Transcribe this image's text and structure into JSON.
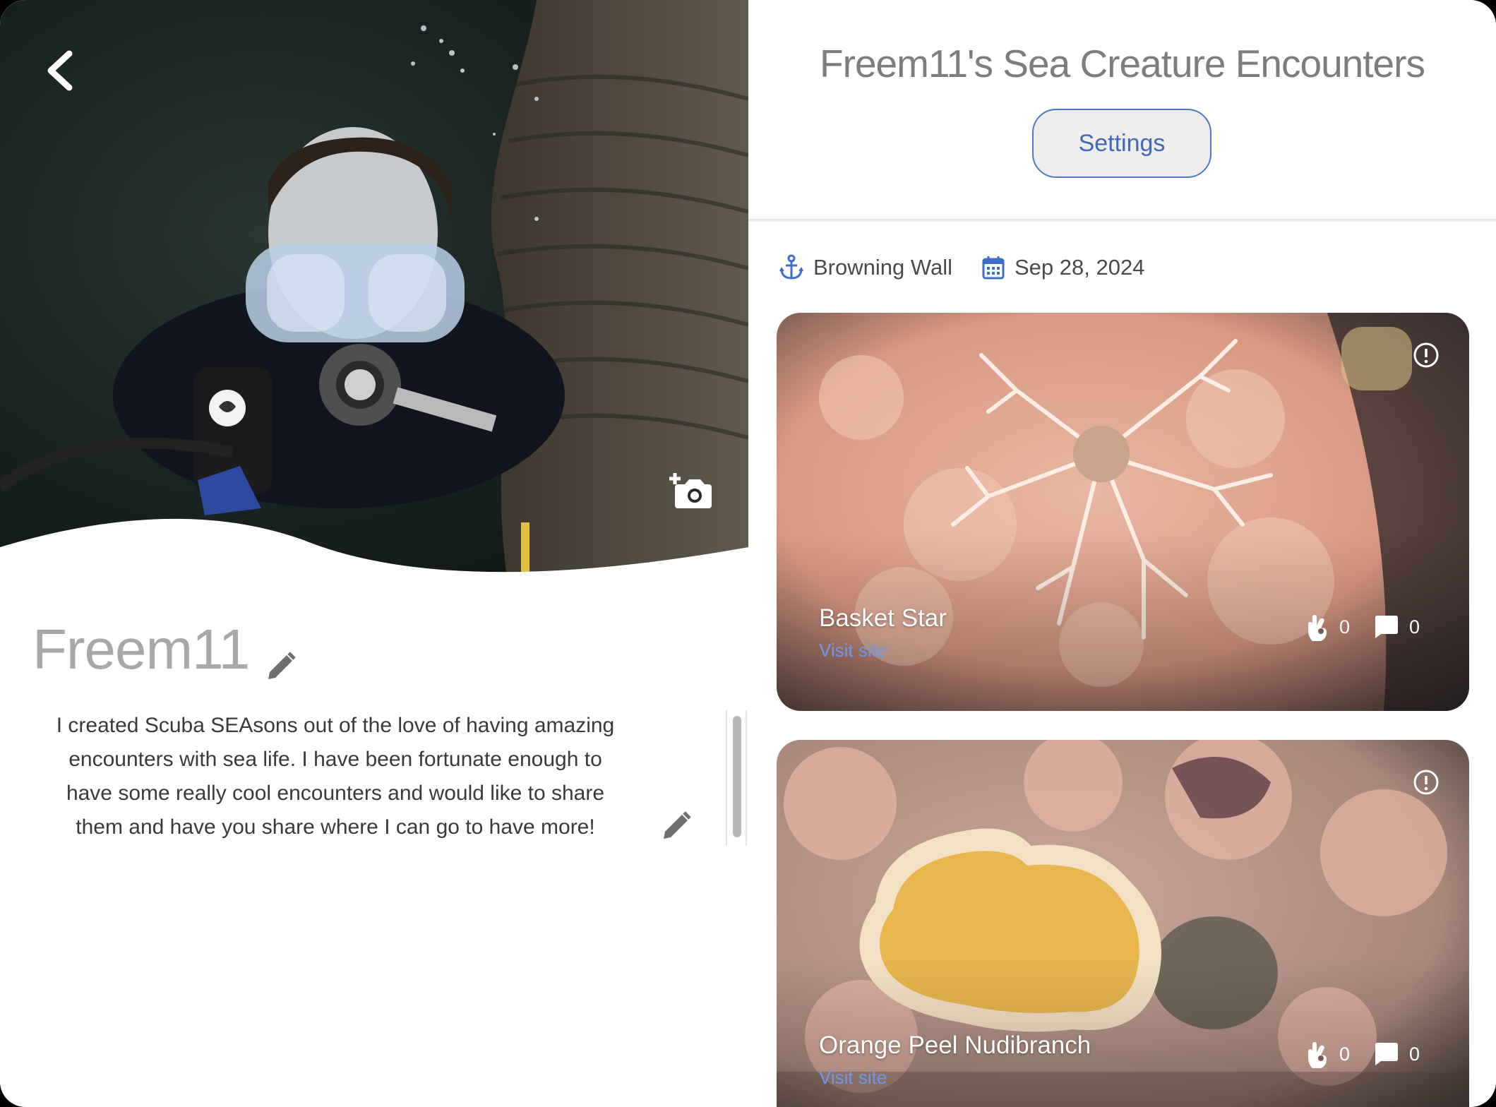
{
  "profile": {
    "username": "Freem11",
    "bio": "I created Scuba SEAsons out of the love of having amazing encounters with sea life. I have been fortunate enough to have some really cool encounters and would like to share them and have you share where I can go to have more!"
  },
  "header": {
    "title": "Freem11's Sea Creature Encounters",
    "settings_label": "Settings"
  },
  "dive": {
    "site": "Browning Wall",
    "date": "Sep 28, 2024"
  },
  "cards": [
    {
      "name": "Basket Star",
      "link": "Visit site",
      "likes": "0",
      "comments": "0"
    },
    {
      "name": "Orange Peel Nudibranch",
      "link": "Visit site",
      "likes": "0",
      "comments": "0"
    }
  ],
  "icons": {
    "back": "chevron-left-icon",
    "camera": "add-photo-icon",
    "edit": "pencil-icon",
    "site": "anchor-icon",
    "date": "calendar-icon",
    "likes": "ok-hand-icon",
    "comments": "comment-icon",
    "report": "alert-circle-icon"
  },
  "colors": {
    "accent": "#4169b8",
    "link": "#6f98e6",
    "title": "#7d7d7d"
  }
}
